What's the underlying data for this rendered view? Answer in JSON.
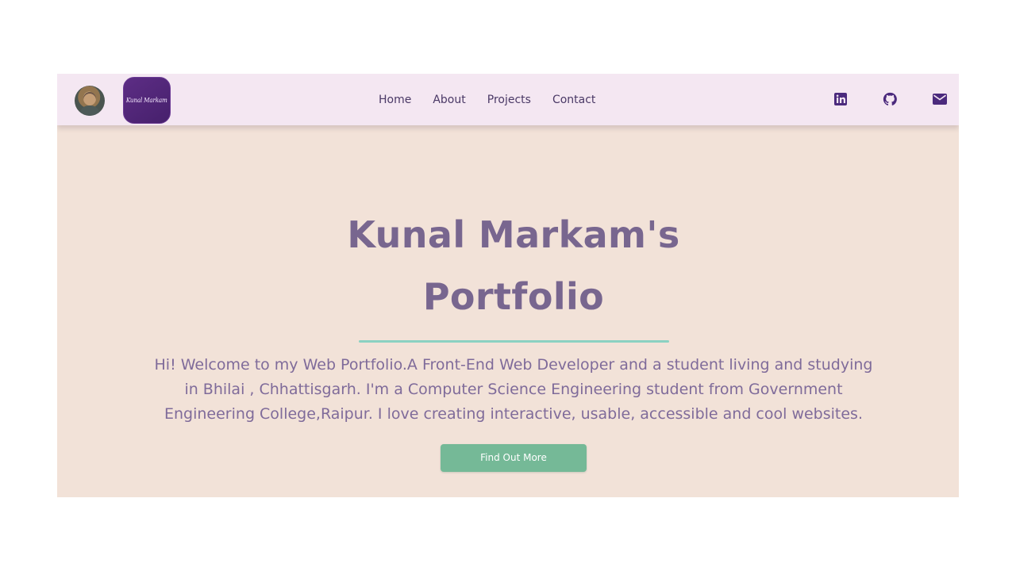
{
  "navbar": {
    "logo_text": "Kunal Markam",
    "links": [
      {
        "label": "Home"
      },
      {
        "label": "About"
      },
      {
        "label": "Projects"
      },
      {
        "label": "Contact"
      }
    ],
    "social_icons": [
      {
        "icon": "linkedin-icon"
      },
      {
        "icon": "github-icon"
      },
      {
        "icon": "mail-icon"
      }
    ]
  },
  "hero": {
    "title": "Kunal Markam's Portfolio",
    "description": "Hi! Welcome to my Web Portfolio.A Front-End Web Developer and a student living and studying in Bhilai , Chhattisgarh. I'm a Computer Science Engineering student from Government Engineering College,Raipur. I love creating interactive, usable, accessible and cool websites.",
    "button_label": "Find Out More"
  },
  "colors": {
    "page_background": "#ffffff",
    "navbar_background": "#f4e7f2",
    "hero_background": "#f2e2d8",
    "title_color": "#78668f",
    "text_color": "#7f6b9a",
    "accent_line": "#8bd1c2",
    "button_background": "#75b997",
    "icon_color": "#4b2a7d"
  }
}
